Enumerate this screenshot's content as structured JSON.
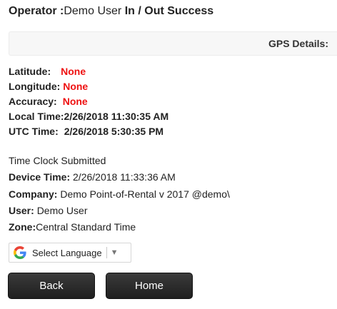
{
  "header": {
    "label_prefix": "Operator :",
    "operator": "Demo User ",
    "status": "In / Out Success"
  },
  "gps": {
    "title": "GPS Details:",
    "latitude_label": "Latitude:",
    "latitude_value": "None",
    "longitude_label": "Longitude:",
    "longitude_value": "None",
    "accuracy_label": "Accuracy:",
    "accuracy_value": "None",
    "local_time_label": "Local Time:",
    "local_time_value": "2/26/2018 11:30:35 AM",
    "utc_time_label": "UTC Time:",
    "utc_time_value": "2/26/2018 5:30:35 PM"
  },
  "info": {
    "submitted_text": "Time Clock Submitted",
    "device_time_label": "Device Time:",
    "device_time_value": "2/26/2018 11:33:36 AM",
    "company_label": "Company:",
    "company_value": "Demo Point-of-Rental v 2017 @demo\\",
    "user_label": "User:",
    "user_value": "Demo User",
    "zone_label": "Zone:",
    "zone_value": "Central Standard Time"
  },
  "language": {
    "label": "Select Language",
    "icon": "google-g-icon",
    "dropdown_icon": "▼"
  },
  "buttons": {
    "back": "Back",
    "home": "Home"
  },
  "colors": {
    "value_red": "#ee1111",
    "button_dark": "#2b2b2b",
    "gps_bar_bg": "#f7f7f7"
  }
}
